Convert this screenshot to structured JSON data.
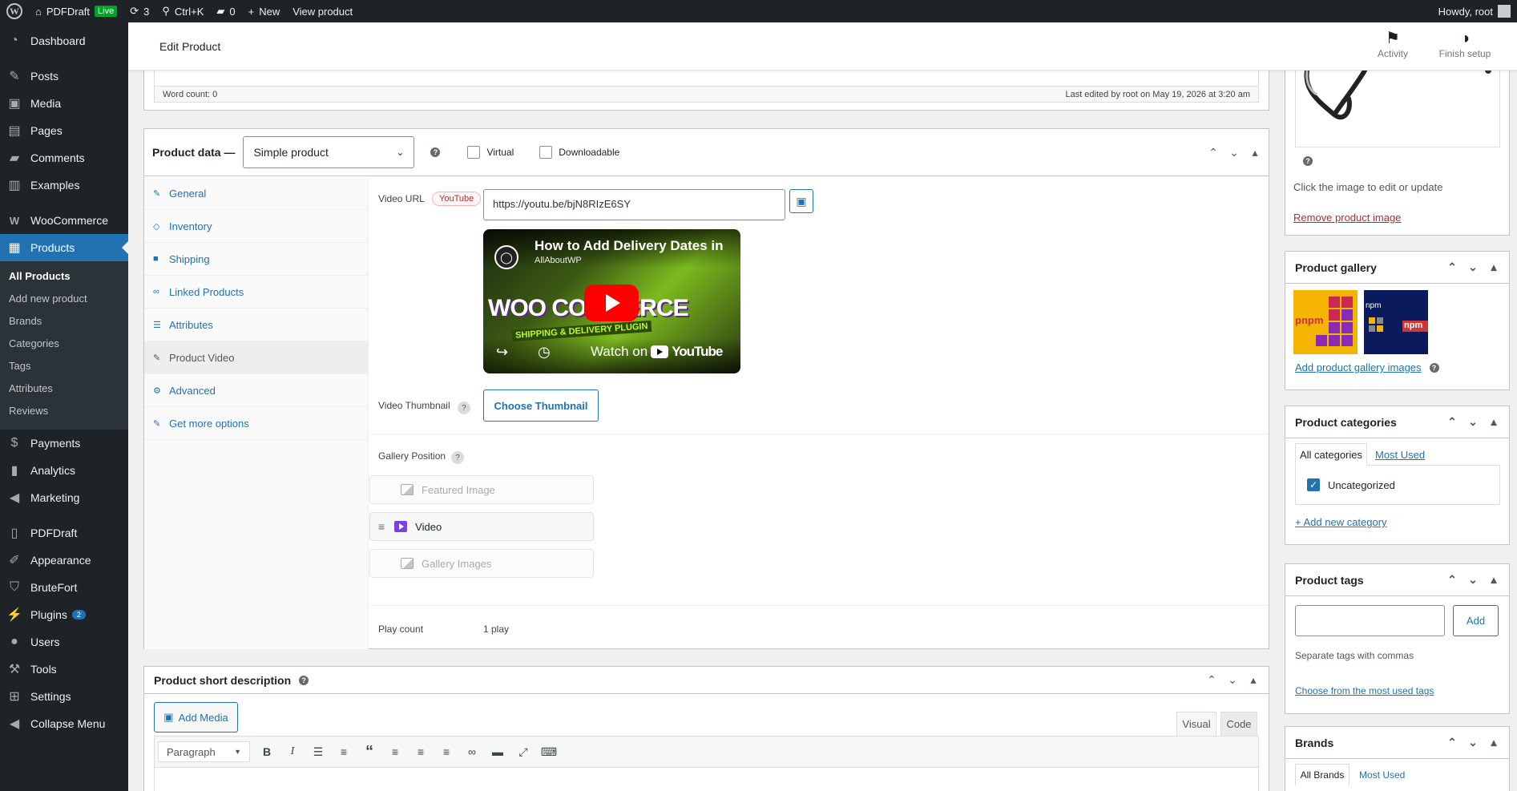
{
  "adminbar": {
    "site_name": "PDFDraft",
    "live_label": "Live",
    "updates_count": "3",
    "search_shortcut": "Ctrl+K",
    "comments_count": "0",
    "new_label": "New",
    "view_product": "View product",
    "howdy": "Howdy, root"
  },
  "menu": {
    "dashboard": "Dashboard",
    "posts": "Posts",
    "media": "Media",
    "pages": "Pages",
    "comments": "Comments",
    "examples": "Examples",
    "woocommerce": "WooCommerce",
    "products": "Products",
    "products_sub": [
      "All Products",
      "Add new product",
      "Brands",
      "Categories",
      "Tags",
      "Attributes",
      "Reviews"
    ],
    "payments": "Payments",
    "analytics": "Analytics",
    "marketing": "Marketing",
    "pdfdraft": "PDFDraft",
    "appearance": "Appearance",
    "brutefort": "BruteFort",
    "plugins": "Plugins",
    "plugins_count": "2",
    "users": "Users",
    "tools": "Tools",
    "settings": "Settings",
    "collapse": "Collapse Menu"
  },
  "header": {
    "title": "Edit Product",
    "activity": "Activity",
    "finish_setup": "Finish setup"
  },
  "editor_status": {
    "word_count": "Word count: 0",
    "last_edited": "Last edited by root on May 19, 2026 at 3:20 am"
  },
  "product_data": {
    "label": "Product data —",
    "type_value": "Simple product",
    "virtual_label": "Virtual",
    "downloadable_label": "Downloadable",
    "tabs": [
      "General",
      "Inventory",
      "Shipping",
      "Linked Products",
      "Attributes",
      "Product Video",
      "Advanced",
      "Get more options"
    ],
    "active_tab": "Product Video",
    "video_url_label": "Video URL",
    "youtube_badge": "YouTube",
    "video_url_value": "https://youtu.be/bjN8RIzE6SY",
    "video_title": "How to Add Delivery Dates in",
    "video_channel": "AllAboutWP",
    "watch_on": "Watch on",
    "youtube_logo": "YouTube",
    "thumb_text_1": "WOO COMMERCE",
    "thumb_text_2": "SHIPPING & DELIVERY PLUGIN",
    "thumbnail_label": "Video Thumbnail",
    "choose_thumbnail": "Choose Thumbnail",
    "gallery_position_label": "Gallery Position",
    "gallery_items": [
      "Featured Image",
      "Video",
      "Gallery Images"
    ],
    "play_count_label": "Play count",
    "play_count_value": "1 play"
  },
  "short_description": {
    "title": "Product short description",
    "add_media": "Add Media",
    "tab_visual": "Visual",
    "tab_code": "Code",
    "format_value": "Paragraph"
  },
  "product_image": {
    "hint": "Click the image to edit or update",
    "remove": "Remove product image"
  },
  "product_gallery": {
    "title": "Product gallery",
    "add_link": "Add product gallery images",
    "img1_text": "pnpm",
    "img2_text": "npm"
  },
  "product_categories": {
    "title": "Product categories",
    "tab_all": "All categories",
    "tab_most_used": "Most Used",
    "item": "Uncategorized",
    "add_new": "+ Add new category"
  },
  "product_tags": {
    "title": "Product tags",
    "add_button": "Add",
    "hint": "Separate tags with commas",
    "choose_link": "Choose from the most used tags"
  },
  "brands": {
    "title": "Brands",
    "tab_all": "All Brands",
    "tab_most_used": "Most Used"
  },
  "colors": {
    "admin_dark": "#1d2327",
    "accent": "#2271b1",
    "youtube_red": "#ff0000",
    "remove_red": "#b32d2e"
  }
}
